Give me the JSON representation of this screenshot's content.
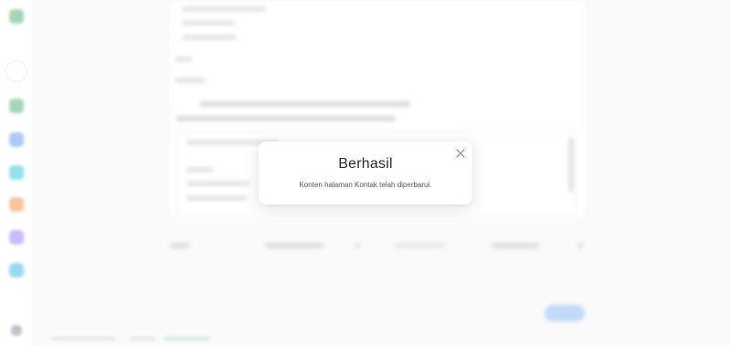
{
  "colors": {
    "accent": "#1e88e5",
    "brand": "#2e9d5b",
    "sidebar_icons": [
      "#2e9d5b",
      "#3b82f6",
      "#06b6d4",
      "#f97316",
      "#8b5cf6",
      "#0ea5e9",
      "#6b7280"
    ]
  },
  "dialog": {
    "title": "Berhasil",
    "message": "Konten halaman Kontak telah diperbarui.",
    "close_icon": "close-icon"
  }
}
